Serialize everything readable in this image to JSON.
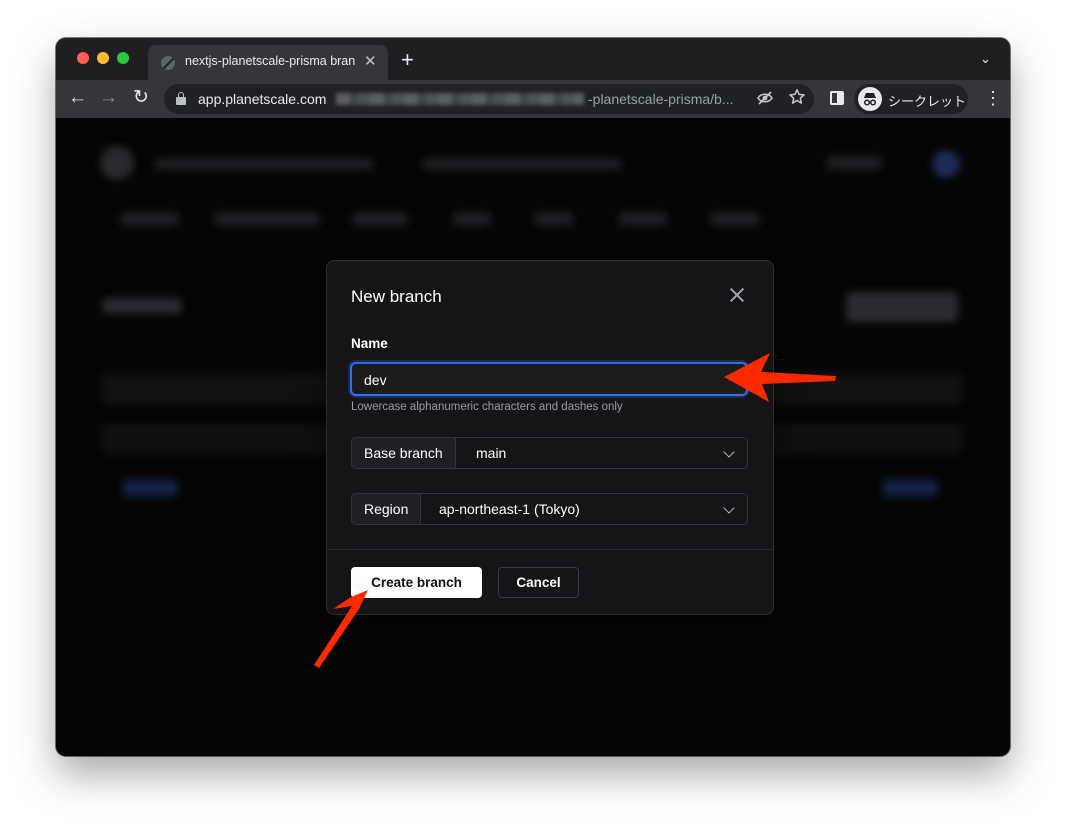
{
  "browser": {
    "tab_title": "nextjs-planetscale-prisma bran",
    "tab_close": "✕",
    "new_tab": "+",
    "url_host": "app.planetscale.com",
    "url_path": "-planetscale-prisma/b...",
    "incognito_label": "シークレット",
    "nav_back": "←",
    "nav_forward": "→",
    "nav_reload": "↻",
    "menu": "⋮",
    "tab_search": "⌄"
  },
  "modal": {
    "title": "New branch",
    "name_label": "Name",
    "name_value": "dev",
    "name_hint": "Lowercase alphanumeric characters and dashes only",
    "base_branch_label": "Base branch",
    "base_branch_value": "main",
    "region_label": "Region",
    "region_value": "ap-northeast-1 (Tokyo)",
    "create_button": "Create branch",
    "cancel_button": "Cancel"
  },
  "annotations": {
    "arrow_color": "#ff2a00"
  },
  "icons": [
    "close-icon",
    "chevron-down-icon",
    "lock-icon",
    "eye-slash-icon",
    "star-icon",
    "side-panel-icon",
    "incognito-icon",
    "more-menu-icon"
  ]
}
